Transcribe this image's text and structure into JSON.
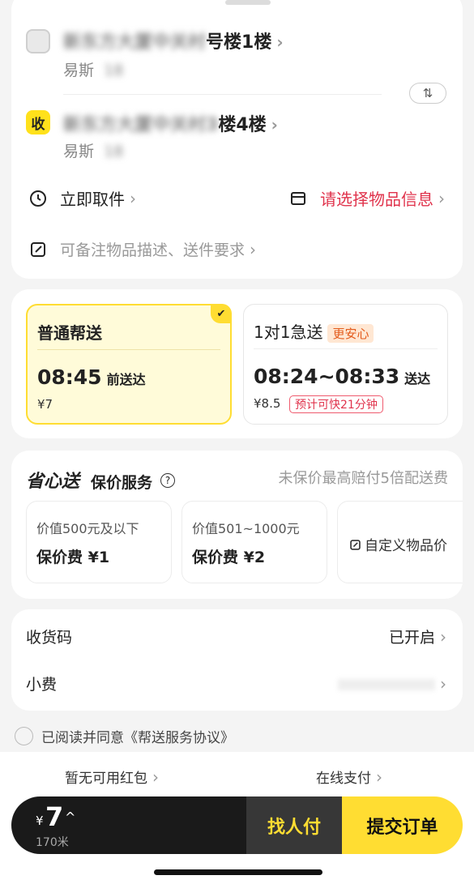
{
  "addresses": {
    "sender": {
      "badge": "",
      "line_blurred": "新东方大厦中关村",
      "line": "号楼1楼",
      "contact_name": "易斯",
      "contact_phone_blurred": "18",
      "chevron": "›"
    },
    "receiver": {
      "badge": "收",
      "line_blurred": "新东方大厦中关村3",
      "line": "楼4楼",
      "contact_name": "易斯",
      "contact_phone_blurred": "18",
      "chevron": "›"
    },
    "swap_icon": "⇅"
  },
  "pickup": {
    "label": "立即取件",
    "chevron": "›",
    "icon": "clock-icon"
  },
  "item_info": {
    "label": "请选择物品信息",
    "chevron": "›",
    "icon": "box-icon",
    "color": "#e0334c"
  },
  "remark": {
    "placeholder": "可备注物品描述、送件要求",
    "chevron": "›",
    "icon": "edit-icon"
  },
  "delivery_options": [
    {
      "title": "普通帮送",
      "time": "08:45",
      "time_suffix": "前送达",
      "price": "¥7",
      "selected": true,
      "check": "✔"
    },
    {
      "title": "1对1急送",
      "tag": "更安心",
      "time": "08:24~08:33",
      "time_suffix": "送达",
      "price": "¥8.5",
      "badge": "预计可快21分钟"
    }
  ],
  "insurance": {
    "logo": "省心送",
    "title": "保价服务",
    "help_icon": "?",
    "note": "未保价最高赔付5倍配送费",
    "options": [
      {
        "value": "价值500元及以下",
        "fee": "保价费 ¥1"
      },
      {
        "value": "价值501~1000元",
        "fee": "保价费 ¥2"
      },
      {
        "custom": "自定义物品价"
      }
    ]
  },
  "settings": [
    {
      "label": "收货码",
      "value": "已开启",
      "chevron": "›"
    },
    {
      "label": "小费",
      "value": "",
      "chevron": "›"
    }
  ],
  "agreement": {
    "text": "已阅读并同意《帮送服务协议》"
  },
  "bottom": {
    "coupon": "暂无可用红包",
    "payment": "在线支付",
    "chevron": "›",
    "currency": "¥",
    "amount": "7",
    "caret": "^",
    "distance": "170米",
    "pay_other": "找人付",
    "submit": "提交订单"
  },
  "colors": {
    "accent": "#ffdd32",
    "danger": "#e0334c",
    "dark": "#1a1a1a"
  }
}
